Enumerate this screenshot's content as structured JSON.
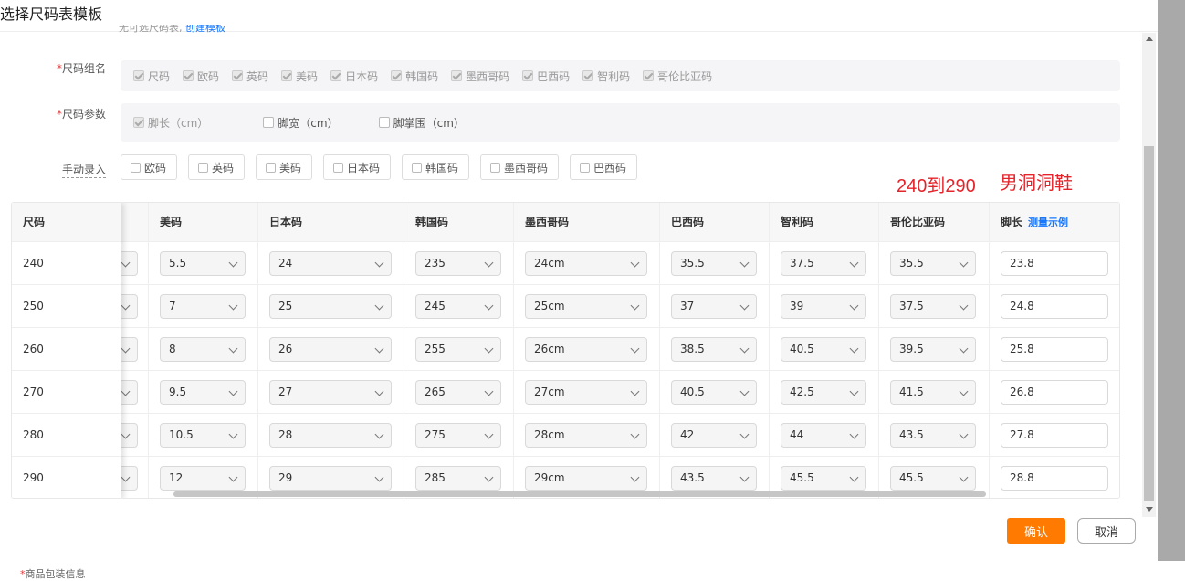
{
  "dialog": {
    "title": "选择尺码表模板",
    "cut_hint_text": "无可选尺码表,",
    "cut_hint_link": "创建模板"
  },
  "size_group": {
    "label": "尺码组名",
    "options": [
      "尺码",
      "欧码",
      "英码",
      "美码",
      "日本码",
      "韩国码",
      "墨西哥码",
      "巴西码",
      "智利码",
      "哥伦比亚码"
    ]
  },
  "size_params": {
    "label": "尺码参数",
    "options": [
      {
        "label": "脚长（cm）",
        "checked": true,
        "disabled": true
      },
      {
        "label": "脚宽（cm）",
        "checked": false,
        "disabled": false
      },
      {
        "label": "脚掌围（cm）",
        "checked": false,
        "disabled": false
      }
    ]
  },
  "manual_entry": {
    "label": "手动录入",
    "options": [
      "欧码",
      "英码",
      "美码",
      "日本码",
      "韩国码",
      "墨西哥码",
      "巴西码"
    ]
  },
  "annotations": {
    "range": "240到290",
    "product": "男洞洞鞋"
  },
  "table": {
    "fixed_header": "尺码",
    "headers": [
      "美码",
      "日本码",
      "韩国码",
      "墨西哥码",
      "巴西码",
      "智利码",
      "哥伦比亚码",
      "脚长"
    ],
    "foot_length_link": "测量示例",
    "rows": [
      {
        "size": "240",
        "us": "5.5",
        "jp": "24",
        "kr": "235",
        "mx": "24cm",
        "br": "35.5",
        "cl": "37.5",
        "co": "35.5",
        "foot": "23.8"
      },
      {
        "size": "250",
        "us": "7",
        "jp": "25",
        "kr": "245",
        "mx": "25cm",
        "br": "37",
        "cl": "39",
        "co": "37.5",
        "foot": "24.8"
      },
      {
        "size": "260",
        "us": "8",
        "jp": "26",
        "kr": "255",
        "mx": "26cm",
        "br": "38.5",
        "cl": "40.5",
        "co": "39.5",
        "foot": "25.8"
      },
      {
        "size": "270",
        "us": "9.5",
        "jp": "27",
        "kr": "265",
        "mx": "27cm",
        "br": "40.5",
        "cl": "42.5",
        "co": "41.5",
        "foot": "26.8"
      },
      {
        "size": "280",
        "us": "10.5",
        "jp": "28",
        "kr": "275",
        "mx": "28cm",
        "br": "42",
        "cl": "44",
        "co": "43.5",
        "foot": "27.8"
      },
      {
        "size": "290",
        "us": "12",
        "jp": "29",
        "kr": "285",
        "mx": "29cm",
        "br": "43.5",
        "cl": "45.5",
        "co": "45.5",
        "foot": "28.8"
      }
    ]
  },
  "footer": {
    "confirm": "确认",
    "cancel": "取消"
  },
  "below": {
    "text": "商品包装信息"
  },
  "colors": {
    "accent": "#ff7a00",
    "link": "#1677ff",
    "annotation": "#e4242b"
  }
}
